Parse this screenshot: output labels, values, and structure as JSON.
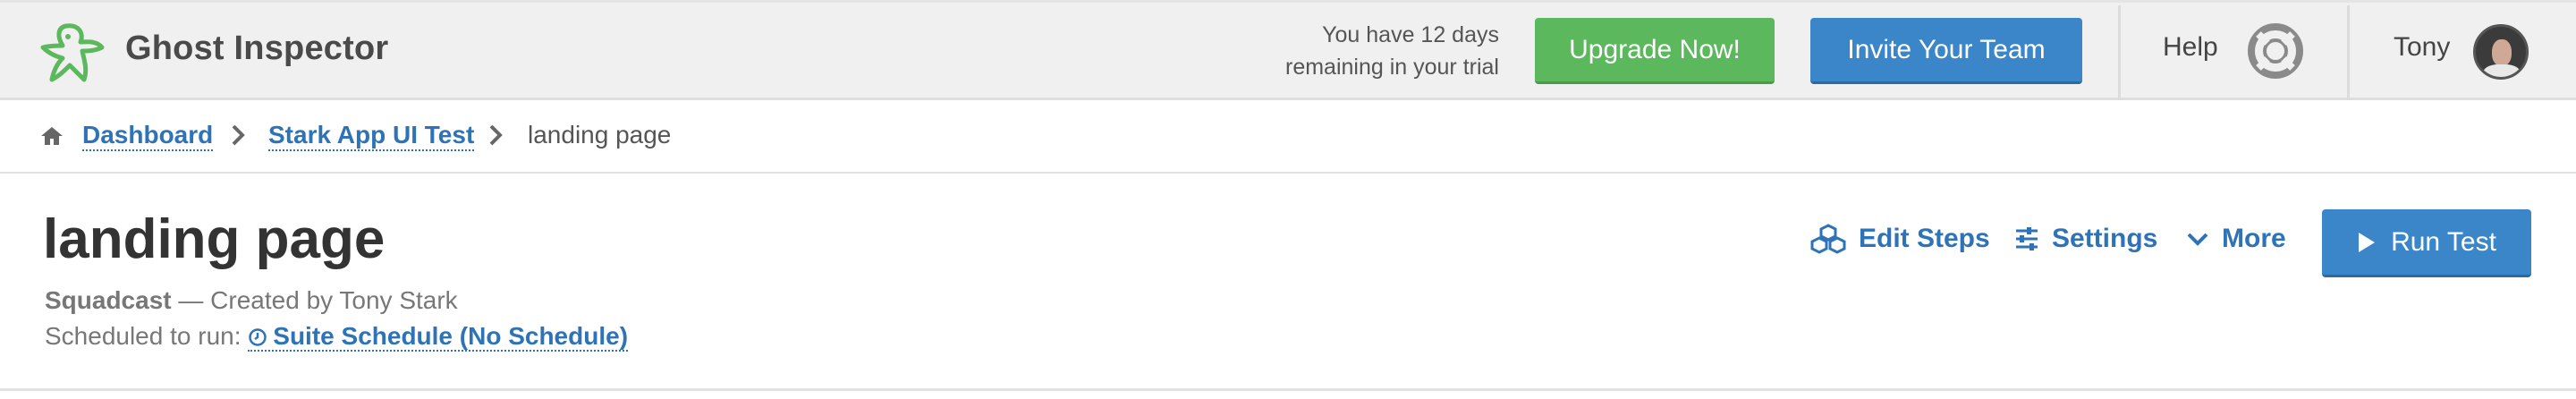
{
  "brand": {
    "name": "Ghost Inspector",
    "logo_icon": "ghost-logo-icon",
    "logo_color": "#5cb85c"
  },
  "trial": {
    "line1": "You have 12 days",
    "line2": "remaining in your trial"
  },
  "header": {
    "upgrade_label": "Upgrade Now!",
    "invite_label": "Invite Your Team",
    "help_label": "Help",
    "help_icon": "lifebuoy-icon",
    "user_name": "Tony"
  },
  "breadcrumb": {
    "home_icon": "home-icon",
    "items": [
      {
        "label": "Dashboard"
      },
      {
        "label": "Stark App UI Test"
      }
    ],
    "current": "landing page"
  },
  "page": {
    "title": "landing page",
    "organization": "Squadcast",
    "created_by": "— Created by Tony Stark",
    "scheduled_prefix": "Scheduled to run:",
    "schedule_link": "Suite Schedule (No Schedule)"
  },
  "actions": {
    "edit_steps": "Edit Steps",
    "settings": "Settings",
    "more": "More",
    "run_test": "Run Test"
  },
  "colors": {
    "primary": "#3a86c8",
    "success": "#5cb85c",
    "link": "#2e72b8",
    "topbar_bg": "#f0f0f0"
  }
}
